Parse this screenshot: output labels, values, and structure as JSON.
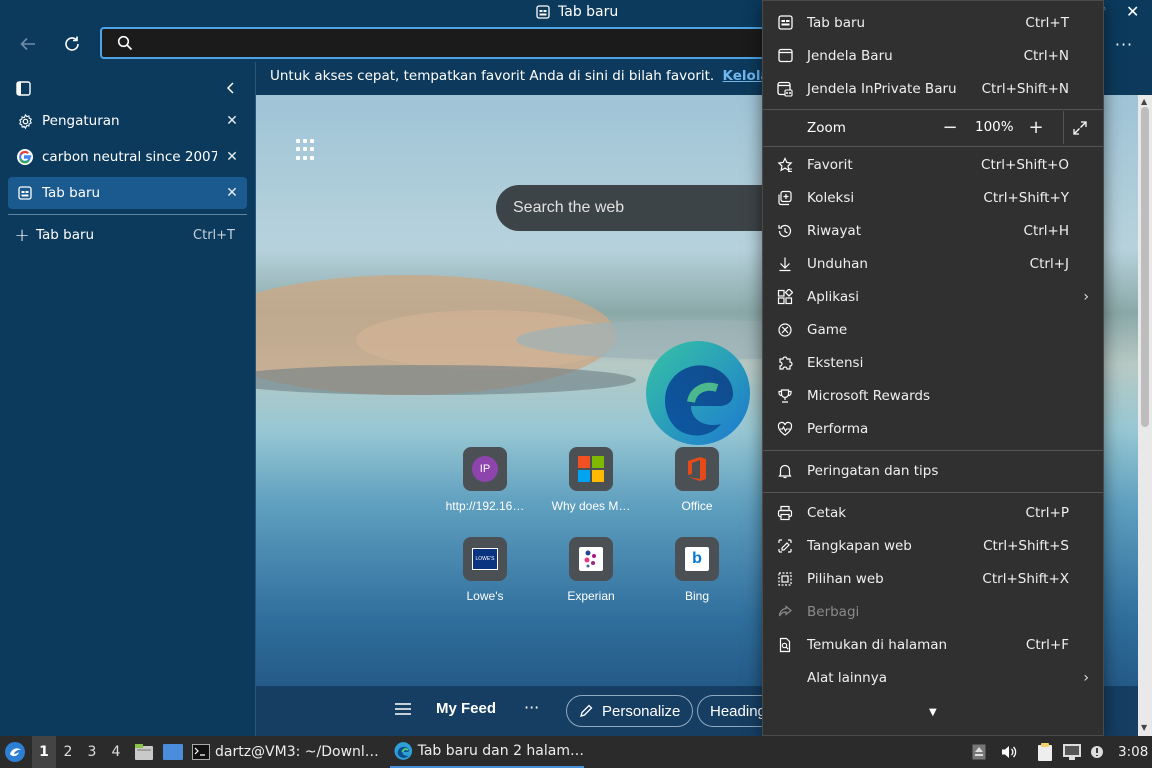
{
  "window": {
    "title": "Tab baru"
  },
  "address": {
    "value": "",
    "placeholder": ""
  },
  "sidebar": {
    "tabs": [
      {
        "label": "Pengaturan",
        "icon": "gear-icon"
      },
      {
        "label": "carbon neutral since 2007",
        "icon": "google-icon"
      },
      {
        "label": "Tab baru",
        "icon": "newtab-icon",
        "active": true
      }
    ],
    "new_tab": {
      "label": "Tab baru",
      "shortcut": "Ctrl+T"
    }
  },
  "favbar": {
    "text": "Untuk akses cepat, tempatkan favorit Anda di sini di bilah favorit.",
    "link": "Kelola f"
  },
  "newtab_page": {
    "search_placeholder": "Search the web",
    "tiles": [
      {
        "label": "http://192.16…",
        "badge": "IP"
      },
      {
        "label": "Why does M…"
      },
      {
        "label": "Office"
      },
      {
        "label": "Lowe's",
        "badge": "LOWE'S"
      },
      {
        "label": "Experian"
      },
      {
        "label": "Bing",
        "badge": "b"
      }
    ],
    "feed": {
      "my_feed": "My Feed",
      "personalize": "Personalize",
      "heading": "Heading"
    }
  },
  "menu": {
    "items": [
      {
        "label": "Tab baru",
        "shortcut": "Ctrl+T"
      },
      {
        "label": "Jendela Baru",
        "shortcut": "Ctrl+N"
      },
      {
        "label": "Jendela InPrivate Baru",
        "shortcut": "Ctrl+Shift+N"
      },
      {
        "label": "Favorit",
        "shortcut": "Ctrl+Shift+O"
      },
      {
        "label": "Koleksi",
        "shortcut": "Ctrl+Shift+Y"
      },
      {
        "label": "Riwayat",
        "shortcut": "Ctrl+H"
      },
      {
        "label": "Unduhan",
        "shortcut": "Ctrl+J"
      },
      {
        "label": "Aplikasi",
        "shortcut": ""
      },
      {
        "label": "Game",
        "shortcut": ""
      },
      {
        "label": "Ekstensi",
        "shortcut": ""
      },
      {
        "label": "Microsoft Rewards",
        "shortcut": ""
      },
      {
        "label": "Performa",
        "shortcut": ""
      },
      {
        "label": "Peringatan dan tips",
        "shortcut": ""
      },
      {
        "label": "Cetak",
        "shortcut": "Ctrl+P"
      },
      {
        "label": "Tangkapan web",
        "shortcut": "Ctrl+Shift+S"
      },
      {
        "label": "Pilihan web",
        "shortcut": "Ctrl+Shift+X"
      },
      {
        "label": "Berbagi",
        "shortcut": "",
        "disabled": true
      },
      {
        "label": "Temukan di halaman",
        "shortcut": "Ctrl+F"
      },
      {
        "label": "Alat lainnya",
        "shortcut": ""
      }
    ],
    "zoom": {
      "label": "Zoom",
      "value": "100%"
    }
  },
  "taskbar": {
    "workspaces": [
      "1",
      "2",
      "3",
      "4"
    ],
    "tasks": [
      {
        "label": "dartz@VM3: ~/Downl…"
      },
      {
        "label": "Tab baru dan 2 halam…"
      }
    ],
    "clock": "3:08"
  },
  "colors": {
    "accent": "#4da3e6",
    "titlebar": "#0b3a5d",
    "menu_bg": "#303030",
    "active_tab": "#1a5a8e"
  }
}
